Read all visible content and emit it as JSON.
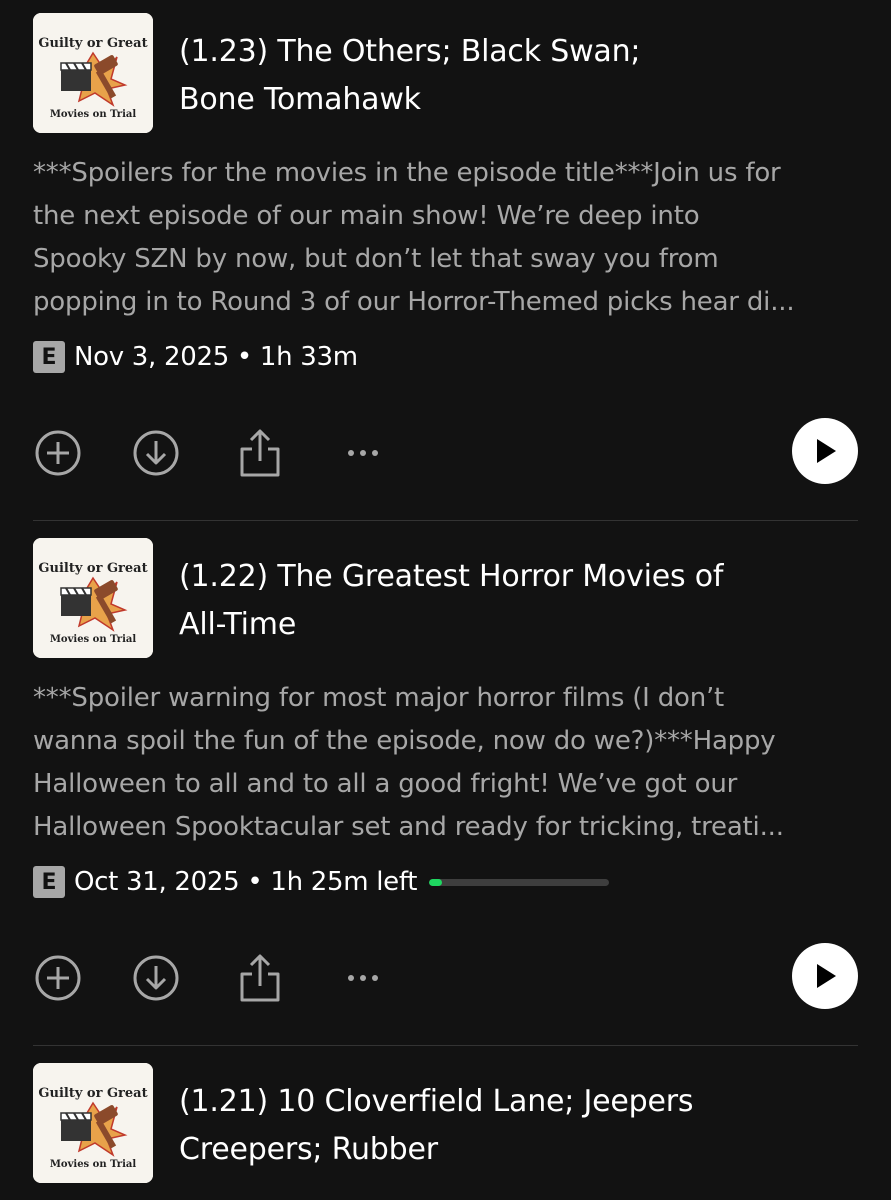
{
  "podcast": {
    "cover_top": "Guilty or Great",
    "cover_bottom": "Movies on Trial"
  },
  "episodes": [
    {
      "title_line1": "(1.23) The Others; Black Swan;",
      "title_line2": "Bone Tomahawk",
      "desc_lines": [
        "***Spoilers for the movies in the episode title***Join us for",
        "the next episode of our main show! We’re deep into",
        "Spooky SZN by now, but don’t let that sway you from",
        "popping in to Round 3 of our Horror-Themed picks hear di..."
      ],
      "explicit": "E",
      "meta": "Nov 3, 2025 • 1h 33m"
    },
    {
      "title_line1": "(1.22) The Greatest Horror Movies of",
      "title_line2": "All-Time",
      "desc_lines": [
        "***Spoiler warning for most major horror films (I don’t",
        "wanna spoil the fun of the episode, now do we?)***Happy",
        "Halloween to all and to all a good fright! We’ve got our",
        "Halloween Spooktacular set and ready for tricking, treati..."
      ],
      "explicit": "E",
      "meta": "Oct 31, 2025 • 1h 25m left",
      "progress": 0.07
    },
    {
      "title_line1": "(1.21) 10 Cloverfield Lane; Jeepers",
      "title_line2": "Creepers; Rubber"
    }
  ],
  "icons": {
    "add": "plus-circle-icon",
    "download": "download-circle-icon",
    "share": "share-icon",
    "more": "more-horizontal-icon",
    "play": "play-icon"
  },
  "colors": {
    "background": "#121212",
    "text_primary": "#ffffff",
    "text_secondary": "#a7a7a7",
    "progress_accent": "#1ed760"
  }
}
